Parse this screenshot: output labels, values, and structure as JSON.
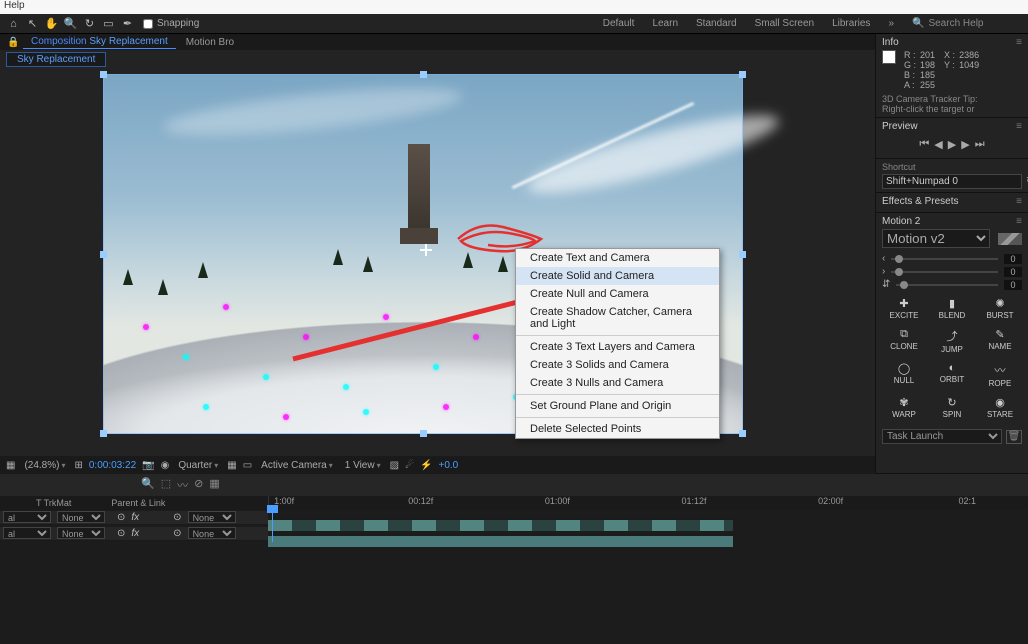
{
  "menu": {
    "help": "Help"
  },
  "toolbar": {
    "snapping": "Snapping",
    "workspaces": [
      "Default",
      "Learn",
      "Standard",
      "Small Screen",
      "Libraries"
    ],
    "search_placeholder": "Search Help"
  },
  "tabs": {
    "comp_prefix": "Composition",
    "comp_name": "Sky Replacement",
    "motion": "Motion Bro",
    "subtab": "Sky Replacement"
  },
  "context_menu": {
    "items_a": [
      "Create Text and Camera",
      "Create Solid and Camera",
      "Create Null and Camera",
      "Create Shadow Catcher, Camera and Light"
    ],
    "items_b": [
      "Create 3 Text Layers and Camera",
      "Create 3 Solids and Camera",
      "Create 3 Nulls and Camera"
    ],
    "items_c": [
      "Set Ground Plane and Origin"
    ],
    "items_d": [
      "Delete Selected Points"
    ],
    "highlight_index": 1
  },
  "vp_footer": {
    "zoom": "(24.8%)",
    "time": "0:00:03:22",
    "quality": "Quarter",
    "camera": "Active Camera",
    "view": "1 View",
    "exposure": "+0.0"
  },
  "info": {
    "title": "Info",
    "R": "201",
    "G": "198",
    "B": "185",
    "A": "255",
    "X": "2386",
    "Y": "1049",
    "tip": "3D Camera Tracker Tip:\nRight-click the target or"
  },
  "preview": {
    "title": "Preview"
  },
  "shortcut": {
    "title": "Shortcut",
    "value": "Shift+Numpad 0"
  },
  "effects": {
    "title": "Effects & Presets"
  },
  "motion2": {
    "title": "Motion 2",
    "preset": "Motion v2",
    "buttons": [
      "EXCITE",
      "BLEND",
      "BURST",
      "CLONE",
      "JUMP",
      "NAME",
      "NULL",
      "ORBIT",
      "ROPE",
      "WARP",
      "SPIN",
      "STARE"
    ],
    "icons": [
      "✚",
      "▮",
      "✺",
      "⧉",
      "⤴",
      "✎",
      "◯",
      "◐",
      "〰",
      "✾",
      "↻",
      "◉"
    ],
    "slider_vals": [
      "0",
      "0",
      "0"
    ],
    "task": "Task Launch"
  },
  "timeline": {
    "time_marks": [
      "1:00f",
      "00:12f",
      "01:00f",
      "01:12f",
      "02:00f",
      "02:1"
    ],
    "col_trkmat": "T   TrkMat",
    "col_parent": "Parent & Link",
    "rows": [
      {
        "mode": "al",
        "trk": "None",
        "parent": "None",
        "fx": "fx"
      },
      {
        "mode": "al",
        "trk": "None",
        "parent": "None",
        "fx": "fx"
      }
    ]
  }
}
